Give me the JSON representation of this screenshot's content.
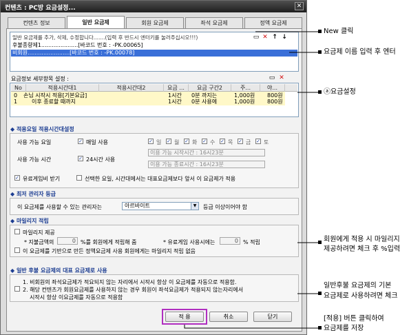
{
  "window": {
    "title": "컨텐츠 : PC방 요금설정...",
    "close_icon": "close-icon"
  },
  "tabs": [
    {
      "label": "컨텐츠 정보"
    },
    {
      "label": "일반 요금제"
    },
    {
      "label": "회원 요금제"
    },
    {
      "label": "좌석 요금제"
    },
    {
      "label": "정액 요금제"
    }
  ],
  "plans": {
    "instruction": "일반 요금제를 추가, 삭제, 수정합니다.......(입력 후 반드시 엔터키를 눌러주십시오!!!)",
    "rows": [
      {
        "text": "후불종량제1.....................[바코드 번호 : -PK.00065]",
        "selected": false
      },
      {
        "text": "비회원........................[바코드 번호 : -PK.00078]",
        "selected": true
      }
    ]
  },
  "detail": {
    "title": "요금정보 세부항목 설정 :",
    "columns": [
      "No",
      "적용시간대1",
      "적용시간대2",
      "요금 ...",
      "요금 구간2",
      "주...",
      "야..."
    ],
    "rows": [
      {
        "no": "0",
        "t1": "손님 시작시 적용[기본요금]",
        "t2": "",
        "c3": "1시간",
        "c4": "0분 까지는",
        "c5": "1,000원",
        "c6": "800원"
      },
      {
        "no": "1",
        "t1": "이후 종료할 때까지",
        "t2": "",
        "c3": "1시간",
        "c4": "0분 사용에",
        "c5": "1,000원",
        "c6": "800원"
      }
    ]
  },
  "apply_time": {
    "section": "적용요일 적용시간대설정",
    "days_label": "사용 가능 요일",
    "every_day": "매일 사용",
    "days": [
      "일",
      "월",
      "화",
      "수",
      "목",
      "금",
      "토"
    ],
    "time_label": "사용 가능 시간",
    "all_day": "24시간 사용",
    "start_placeholder": "이용 가능 시작시간 : 16시23분",
    "end_placeholder": "이용 가능 종료시간 : 16시23분",
    "paid_game": "유료게임비 받기",
    "priority_note": "선택한 요일, 시간대에서는 대표요금제보다 앞서 이 요금제가 적용"
  },
  "manager": {
    "section": "최저 관리자 등급",
    "prefix": "이 요금제를 사용할 수 있는 관리자는",
    "level": "아르바이트",
    "suffix": "등급 이상이어야 함"
  },
  "mileage": {
    "section": "마일리지 적립",
    "provide": "마일리지 제공",
    "pay_amount_prefix": "* 지불금액의",
    "pay_amount_value": "0",
    "pay_amount_suffix": "%를 회원에게 적립해 줌",
    "paid_game_prefix": "* 유료게임 사용시에는",
    "paid_game_value": "0",
    "paid_game_suffix": "% 적립",
    "no_mileage": "이 요금제를 기반으로 만든 정액요금제 사용 회원에게는 마일리지 적립 없음"
  },
  "default_plan": {
    "section": "일반 후불 요금제의 대표 요금제로 사용",
    "line1": "1. 비회원의 좌석요금제가 적요되지 않는 자리에서 시작시 항상 이 요금제를 자동으로 적용함.",
    "line2": "2. 해당 컨텐츠가 회원요금제를 사용하지 않는 경우 회원이 좌석요금제가 적용되지 않는자리에서",
    "line3": "시작시 항상 이요금제를 자동으로 적용함"
  },
  "buttons": {
    "apply": "적 용",
    "cancel": "취소",
    "close": "닫기"
  },
  "annotations": {
    "new_click": "New 클릭",
    "enter_name": "요금제 이름 입력 후 엔터",
    "fee_setting": "ⓐ요금설정",
    "mileage_note_1": "회원에게 적용 시 마일리지",
    "mileage_note_2": "제공하려면 체크 후 %입력",
    "default_note_1": "일반후불 요금제의 기본",
    "default_note_2": "요금제로    사용하려면 체크",
    "apply_note_1": "[적용] 버튼 클릭하여",
    "apply_note_2": "요금제를 저장"
  }
}
